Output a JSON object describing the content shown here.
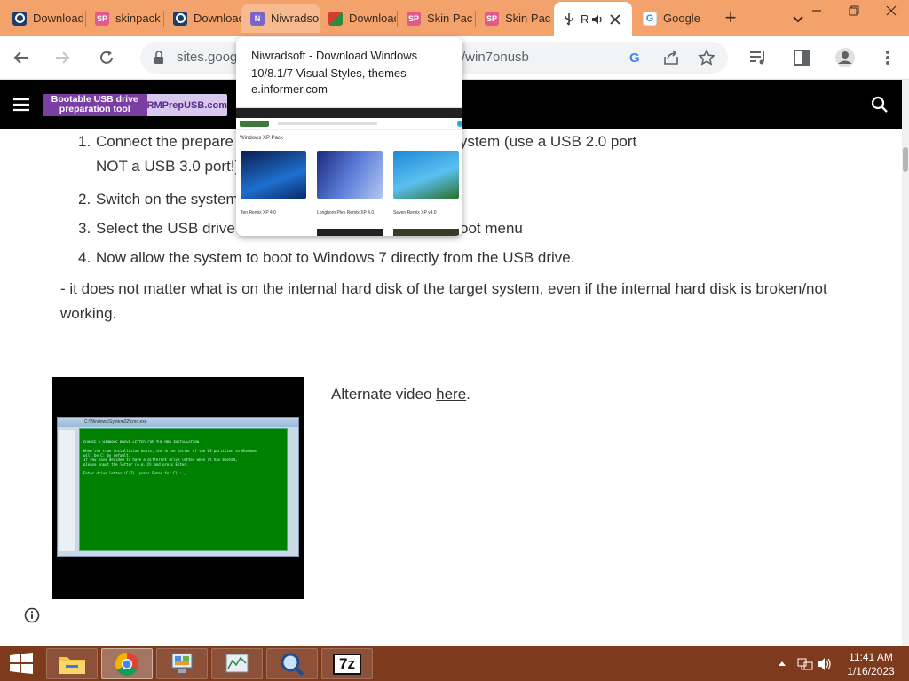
{
  "tabs": [
    {
      "title": "Download",
      "icon": "blue-circle-icon"
    },
    {
      "title": "skinpack",
      "icon": "skinpack-icon"
    },
    {
      "title": "Download",
      "icon": "blue-circle-icon"
    },
    {
      "title": "Niwradso",
      "icon": "niwradsoft-icon"
    },
    {
      "title": "Download",
      "icon": "download-site-icon"
    },
    {
      "title": "Skin Pac",
      "icon": "skinpack-icon"
    },
    {
      "title": "Skin Pac",
      "icon": "skinpack-icon"
    },
    {
      "title": "R",
      "icon": "usb-icon",
      "active": true,
      "audio": true
    },
    {
      "title": "Google",
      "icon": "google-icon"
    }
  ],
  "window": {
    "new_tab": "+",
    "tab_search": "chevron-down-icon"
  },
  "address_bar": {
    "url_start": "sites.goog",
    "url_end": "/win7onusb"
  },
  "hover_card": {
    "title": "Niwradsoft - Download Windows 10/8.1/7 Visual Styles, themes",
    "domain": "e.informer.com",
    "preview": {
      "section": "Windows XP Pack",
      "items": [
        {
          "caption": "Ten Remix XP 4.0"
        },
        {
          "caption": "Longhorn Plex Remix XP 4.0"
        },
        {
          "caption": "Seven Remix XP v4.0"
        }
      ]
    }
  },
  "site": {
    "banner_left": "Bootable USB drive preparation tool",
    "banner_right": "RMPrepUSB.com"
  },
  "content": {
    "steps": [
      {
        "num": "1.",
        "text_a": "Connect the prepare",
        "text_b": "r Flash drive) to the target system (use a USB 2.0 port",
        "text_c": "NOT a USB 3.0 port!)"
      },
      {
        "num": "2.",
        "text_a": "Switch on the system"
      },
      {
        "num": "3.",
        "text_a": "Select the USB drive",
        "text_b": "oot menu"
      },
      {
        "num": "4.",
        "text_a": "Now allow the system to boot to Windows 7 directly from the USB drive."
      }
    ],
    "paragraph": "- it does not matter what is on the internal hard disk of the target system, even if the internal hard disk is broken/not working.",
    "alternate_prefix": "Alternate video ",
    "alternate_link": "here",
    "alternate_suffix": "."
  },
  "video": {
    "window_title": "C:\\Windows\\System32\\cmd.exe",
    "lines": [
      "CHOOSE A WINDOWS DRIVE LETTER FOR THE MBR INSTALLATION",
      "",
      "When the true installation boots, the drive letter of the OS partition to Windows",
      "will be C: by default.",
      "If you have decided to have a different drive letter when it has booted,",
      "please input the letter (e.g. D) and press Enter.",
      "",
      "Enter drive letter (C-Z) (press Enter for C) : _"
    ]
  },
  "taskbar": {
    "apps": [
      "file-explorer",
      "chrome",
      "control-panel",
      "task-manager",
      "magnifier",
      "7-zip"
    ],
    "seven_zip_label": "7z",
    "time": "11:41 AM",
    "date": "1/16/2023"
  }
}
